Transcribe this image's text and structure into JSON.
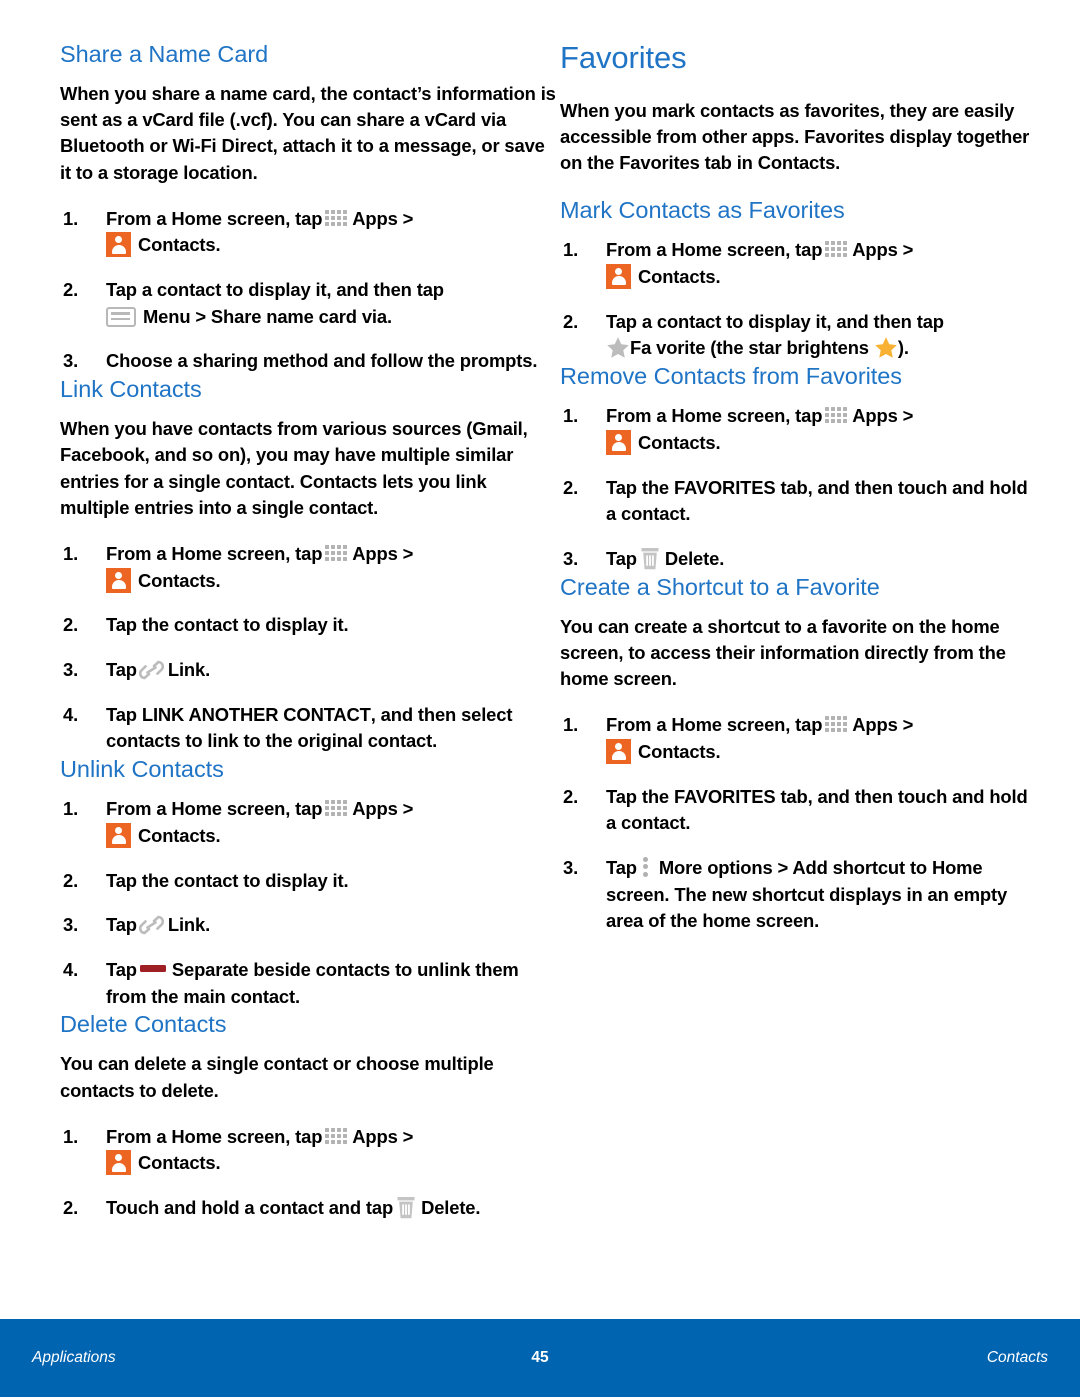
{
  "colors": {
    "heading_blue": "#1f74c5",
    "footer_blue": "#0164b0",
    "contacts_orange": "#ec6523",
    "star_gray": "#bcbcbc",
    "star_gold": "#f8b133",
    "separate_red": "#9e1f24",
    "icon_gray": "#b3b3b3"
  },
  "left_column": {
    "share_name_card": {
      "heading": "Share a Name Card",
      "body": "When you share a name card, the contact’s information is sent as a vCard file (.vcf). You can share a vCard via Bluetooth or Wi-Fi Direct, attach it to a message, or save it to a storage location.",
      "steps": {
        "n1": "1.",
        "s1_a": "From a Home screen, tap",
        "s1_apps": "Apps >",
        "s1_contacts": "Contacts",
        "s1_period": ".",
        "n2": "2.",
        "s2_a": "Tap a contact to display it, and then tap",
        "s2_menu": "Menu > Share name card via",
        "s2_period": ".",
        "n3": "3.",
        "s3_a": "Choose a sharing method and follow the prompts."
      }
    },
    "link_contacts": {
      "heading": "Link Contacts",
      "body": "When you have contacts from various sources (Gmail, Facebook, and so on), you may have multiple similar entries for a single contact. Contacts lets you link multiple entries into a single contact.",
      "steps": {
        "n1": "1.",
        "s1_a": "From a Home screen, tap",
        "s1_apps": "Apps >",
        "s1_contacts": "Contacts",
        "s1_period": ".",
        "n2": "2.",
        "s2_a": "Tap the contact to display it.",
        "n3": "3.",
        "s3_tap": "Tap",
        "s3_link": "Link",
        "s3_period": ".",
        "n4": "4.",
        "s4_tap": "Tap",
        "s4_bold": "LINK ANOTHER CONTACT",
        "s4_rest": ", and then select contacts to link to the original contact."
      }
    },
    "unlink_contacts": {
      "heading": "Unlink Contacts",
      "steps": {
        "n1": "1.",
        "s1_a": "From a Home screen, tap",
        "s1_apps": "Apps >",
        "s1_contacts": "Contacts",
        "s1_period": ".",
        "n2": "2.",
        "s2_a": "Tap the contact to display it.",
        "n3": "3.",
        "s3_tap": "Tap",
        "s3_link": "Link",
        "s3_period": ".",
        "n4": "4.",
        "s4_tap": "Tap",
        "s4_bold": "Separate",
        "s4_rest": "beside contacts to unlink them from the main contact."
      }
    },
    "delete_contacts": {
      "heading": "Delete Contacts",
      "body": "You can delete a single contact or choose multiple contacts to delete.",
      "steps": {
        "n1": "1.",
        "s1_a": "From a Home screen, tap",
        "s1_apps": "Apps >",
        "s1_contacts": "Contacts",
        "s1_period": ".",
        "n2": "2.",
        "s2_a": "Touch and hold a contact and tap",
        "s2_delete": "Delete",
        "s2_period": "."
      }
    }
  },
  "right_column": {
    "favorites": {
      "heading": "Favorites",
      "body": "When you mark contacts as favorites, they are easily accessible from other apps. Favorites display together on the Favorites tab in Contacts."
    },
    "mark_contacts": {
      "heading": "Mark Contacts as Favorites",
      "steps": {
        "n1": "1.",
        "s1_a": "From a Home screen, tap",
        "s1_apps": "Apps >",
        "s1_contacts": "Contacts",
        "s1_period": ".",
        "n2": "2.",
        "s2_a": "Tap a contact to display it, and then tap",
        "s2_fav": "Fa vorite",
        "s2_rest": "(the star brightens",
        "s2_end": ")."
      }
    },
    "remove_contacts": {
      "heading": "Remove Contacts from Favorites",
      "steps": {
        "n1": "1.",
        "s1_a": "From a Home screen, tap",
        "s1_apps": "Apps >",
        "s1_contacts": "Contacts",
        "s1_period": ".",
        "n2": "2.",
        "s2_a": "Tap the",
        "s2_bold": "FAVORITES",
        "s2_rest": "tab, and then touch and hold a contact.",
        "n3": "3.",
        "s3_tap": "Tap",
        "s3_delete": "Delete",
        "s3_period": "."
      }
    },
    "create_shortcut": {
      "heading": "Create a Shortcut to a Favorite",
      "body": "You can create a shortcut to a favorite on the home screen, to access their information directly from the home screen.",
      "steps": {
        "n1": "1.",
        "s1_a": "From a Home screen, tap",
        "s1_apps": "Apps >",
        "s1_contacts": "Contacts",
        "s1_period": ".",
        "n2": "2.",
        "s2_a": "Tap the",
        "s2_bold": "FAVORITES",
        "s2_rest": "tab, and then touch and hold a contact.",
        "n3": "3.",
        "s3_tap": "Tap",
        "s3_bold": "More options > Add shortcut to Home screen",
        "s3_rest": ". The new shortcut displays in an empty area of the home screen."
      }
    }
  },
  "footer": {
    "left": "Applications",
    "page_number": "45",
    "right": "Contacts"
  }
}
